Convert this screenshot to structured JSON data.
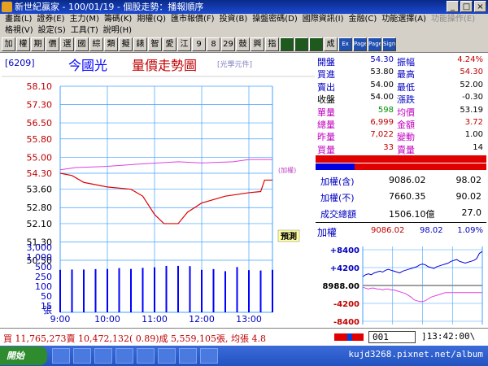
{
  "window": {
    "title": "新世紀贏家 - 100/01/19 - 個股走勢：播報順序"
  },
  "menu": {
    "row1": [
      "畫面(L)",
      "證券(E)",
      "主力(M)",
      "籌碼(K)",
      "期權(Q)",
      "匯市報價(F)",
      "投資(B)",
      "操盤密碼(D)",
      "國際資訊(I)",
      "金融(C)",
      "功能選擇(A)",
      "功能操作(E)"
    ],
    "row2": [
      "格視(V)",
      "設定(S)",
      "工具(T)",
      "說明(H)"
    ]
  },
  "toolbar": [
    "加",
    "權",
    "期",
    "價",
    "選",
    "國",
    "綜",
    "類",
    "擬",
    "錶",
    "智",
    "愛",
    "江",
    "9",
    "8",
    "29",
    "鼓",
    "興",
    "指",
    "",
    "",
    "",
    "成",
    "Ex",
    "Page",
    "Page",
    "Sign"
  ],
  "stock": {
    "code": "[6209]",
    "name": "今國光",
    "chart_title": "量價走勢圖",
    "source": "[光學元件]",
    "index_tag": "(加權)",
    "prediction_label": "預測"
  },
  "quote": {
    "open": {
      "label": "開盤",
      "value": "54.30"
    },
    "amp": {
      "label": "振幅",
      "value": "4.24%"
    },
    "bid": {
      "label": "買進",
      "value": "53.80"
    },
    "high": {
      "label": "最高",
      "value": "54.30"
    },
    "ask": {
      "label": "賣出",
      "value": "54.00"
    },
    "low": {
      "label": "最低",
      "value": "52.00"
    },
    "close": {
      "label": "收盤",
      "value": "54.00"
    },
    "change": {
      "label": "漲跌",
      "value": "-0.30"
    },
    "lot": {
      "label": "單量",
      "value": "598"
    },
    "avg": {
      "label": "均價",
      "value": "53.19"
    },
    "total_vol": {
      "label": "總量",
      "value": "6,999"
    },
    "amount": {
      "label": "金額",
      "value": "3.72"
    },
    "yest_vol": {
      "label": "昨量",
      "value": "7,022"
    },
    "movement": {
      "label": "變動",
      "value": "1.00"
    },
    "buy_vol": {
      "label": "買量",
      "value": "33"
    },
    "sell_vol": {
      "label": "賣量",
      "value": "14"
    }
  },
  "index_summary": {
    "incl": {
      "label": "加權(含)",
      "value": "9086.02",
      "change": "98.02"
    },
    "excl": {
      "label": "加權(不)",
      "value": "7660.35",
      "change": "90.02"
    },
    "turnover": {
      "label": "成交總額",
      "value": "1506.10億",
      "change": "27.0"
    }
  },
  "index_panel": {
    "label": "加權",
    "value": "9086.02",
    "change": "98.02",
    "pct": "1.09%",
    "ref_label": "8988.00"
  },
  "status": {
    "text": "買 11,765,273賣 10,472,132( 0.89)成 5,559,105張, 均張 4.8",
    "input_value": "001",
    "clock": "]13:42:00\\"
  },
  "taskbar": {
    "start_label": "開始",
    "watermark": "kujd3268.pixnet.net/album"
  },
  "colors": {
    "bg": "#ffffff",
    "price_line": "#e00000",
    "index_line": "#e040e0",
    "volume_bar": "#0000ff",
    "grid": "#40a0ff"
  },
  "chart_data": [
    {
      "type": "line",
      "name": "price_volume",
      "y_ticks": [
        "58.10",
        "57.30",
        "56.50",
        "55.80",
        "55.00",
        "54.30",
        "53.60",
        "52.80",
        "52.10",
        "51.30",
        "50.50"
      ],
      "y_ref": 54.3,
      "ylim": [
        50.5,
        58.1
      ],
      "x_ticks": [
        "9:00",
        "10:00",
        "11:00",
        "12:00",
        "13:00"
      ],
      "time_range_min": [
        540,
        810
      ],
      "series": [
        {
          "values_x": [
            540,
            555,
            570,
            600,
            630,
            645,
            660,
            672,
            690,
            702,
            720,
            750,
            780,
            795,
            800,
            810
          ],
          "values_y": [
            54.3,
            54.2,
            53.9,
            53.7,
            53.6,
            53.3,
            52.5,
            52.1,
            52.1,
            52.6,
            53.0,
            53.3,
            53.45,
            53.5,
            54.0,
            54.0
          ]
        },
        {
          "values_x": [
            540,
            560,
            600,
            640,
            690,
            720,
            760,
            780,
            810
          ],
          "values_y": [
            54.45,
            54.55,
            54.6,
            54.7,
            54.8,
            54.75,
            54.8,
            54.9,
            54.9
          ]
        }
      ],
      "vol_ticks": [
        "3,000",
        "1,000",
        "500",
        "250",
        "100",
        "50",
        "15"
      ],
      "vol_unit": "張",
      "volume_x": [
        540,
        555,
        570,
        585,
        600,
        615,
        630,
        645,
        660,
        675,
        690,
        705,
        720,
        735,
        750,
        765,
        780,
        795,
        810
      ],
      "volume": [
        700,
        720,
        720,
        750,
        760,
        820,
        760,
        840,
        880,
        1000,
        1000,
        980,
        700,
        750,
        620,
        900,
        680,
        660,
        700
      ]
    },
    {
      "type": "line",
      "name": "index_mini",
      "y_ticks": [
        "+8400",
        "+4200",
        "8988.00",
        "-4200",
        "-8400"
      ],
      "series": [
        {
          "values": [
            10,
            12,
            13,
            12,
            14,
            15,
            16,
            15,
            17,
            18,
            17,
            16,
            15,
            14,
            16,
            17,
            18,
            19,
            20,
            21,
            23,
            24,
            23,
            21,
            20,
            19,
            21,
            22,
            23,
            24,
            25,
            27,
            28,
            29,
            27,
            26,
            25,
            26,
            27,
            28,
            30,
            36,
            38
          ]
        },
        {
          "values": [
            -2,
            -3,
            -4,
            -3,
            -3,
            -4,
            -4,
            -5,
            -4,
            -4,
            -5,
            -5,
            -6,
            -7,
            -8,
            -9,
            -11,
            -13,
            -16,
            -17,
            -18,
            -18,
            -17,
            -15,
            -13,
            -12,
            -11,
            -10,
            -9,
            -8,
            -8,
            -8,
            -8,
            -8,
            -8,
            -8,
            -8,
            -8,
            -8,
            -8,
            -8,
            -8,
            -8
          ]
        }
      ]
    }
  ]
}
